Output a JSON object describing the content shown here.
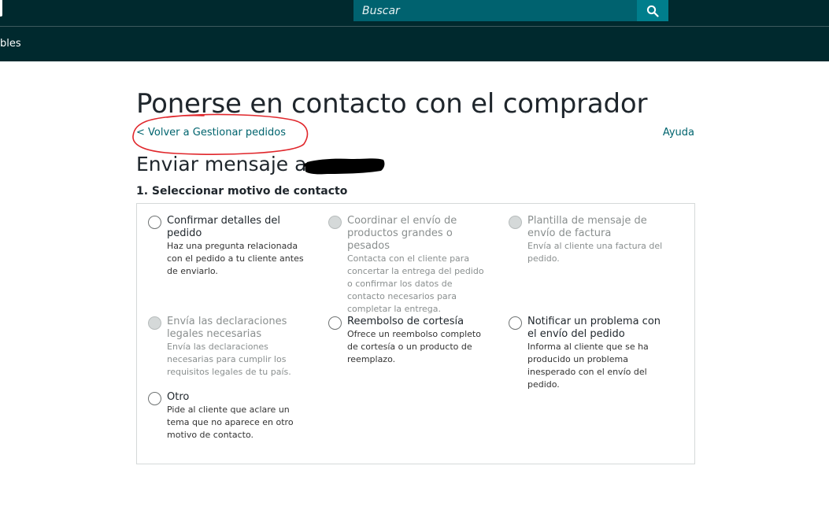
{
  "header": {
    "search_placeholder": "Buscar",
    "nav_label": "bles"
  },
  "page": {
    "title": "Ponerse en contacto con el comprador",
    "back_link": "< Volver a Gestionar pedidos",
    "help_link": "Ayuda",
    "section_title": "Enviar mensaje a",
    "step_title": "1. Seleccionar motivo de contacto"
  },
  "options": [
    {
      "title": "Confirmar detalles del pedido",
      "description": "Haz una pregunta relacionada con el pedido a tu cliente antes de enviarlo.",
      "enabled": true
    },
    {
      "title": "Coordinar el envío de productos grandes o pesados",
      "description": "Contacta con el cliente para concertar la entrega del pedido o confirmar los datos de contacto necesarios para completar la entrega.",
      "enabled": false
    },
    {
      "title": "Plantilla de mensaje de envío de factura",
      "description": "Envía al cliente una factura del pedido.",
      "enabled": false
    },
    {
      "title": "Envía las declaraciones legales necesarias",
      "description": "Envía las declaraciones necesarias para cumplir los requisitos legales de tu país.",
      "enabled": false
    },
    {
      "title": "Reembolso de cortesía",
      "description": "Ofrece un reembolso completo de cortesía o un producto de reemplazo.",
      "enabled": true
    },
    {
      "title": "Notificar un problema con el envío del pedido",
      "description": "Informa al cliente que se ha producido un problema inesperado con el envío del pedido.",
      "enabled": true
    },
    {
      "title": "Otro",
      "description": "Pide al cliente que aclare un tema que no aparece en otro motivo de contacto.",
      "enabled": true
    }
  ],
  "icons": {
    "search": "search-icon"
  },
  "colors": {
    "header_bg": "#00292e",
    "search_bg": "#00626f",
    "search_button": "#007e8c",
    "link": "#00646e",
    "annotation": "#e0262b"
  }
}
